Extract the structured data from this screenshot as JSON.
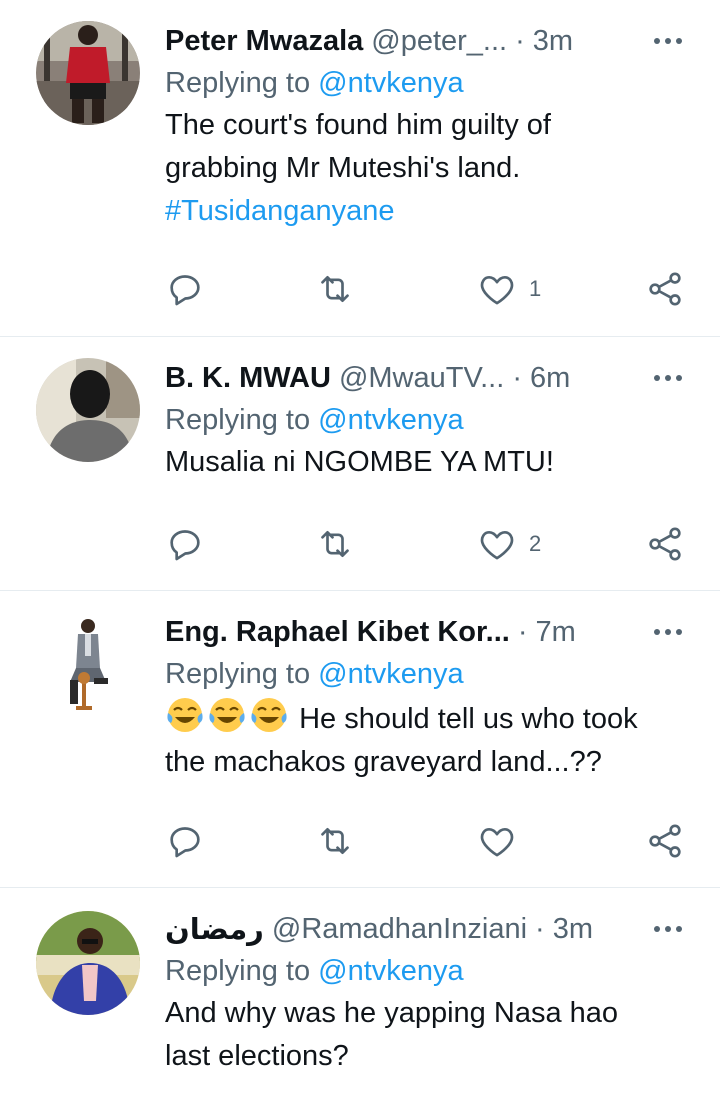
{
  "replying_prefix": "Replying to",
  "tweets": [
    {
      "name": "Peter Mwazala",
      "handle": "@peter_...",
      "dot": "·",
      "time": "3m",
      "reply_to": "@ntvkenya",
      "text_line1": "The court's found him guilty of",
      "text_line2": "grabbing Mr Muteshi's land.",
      "hashtag": "#Tusidanganyane",
      "like_count": "1",
      "avatar_icon": "avatar-photo"
    },
    {
      "name": "B. K. MWAU",
      "handle": "@MwauTV...",
      "dot": "·",
      "time": "6m",
      "reply_to": "@ntvkenya",
      "text": "Musalia ni NGOMBE YA MTU!",
      "like_count": "2",
      "avatar_icon": "avatar-photo"
    },
    {
      "name": "Eng. Raphael Kibet Kor...",
      "dot": "·",
      "time": "7m",
      "reply_to": "@ntvkenya",
      "emoji_icon": "face-with-tears-of-joy-emoji",
      "text_line1": "He should tell us who took",
      "text_line2": "the machakos graveyard land...??",
      "avatar_icon": "avatar-photo"
    },
    {
      "name": "رمضان",
      "handle": "@RamadhanInziani",
      "dot": "·",
      "time": "3m",
      "reply_to": "@ntvkenya",
      "text_line1": "And why was he yapping Nasa hao",
      "text_line2": "last elections?",
      "avatar_icon": "avatar-photo"
    }
  ],
  "icons": {
    "reply": "reply-icon",
    "retweet": "retweet-icon",
    "like": "heart-icon",
    "share": "share-icon",
    "more": "more-icon"
  },
  "colors": {
    "link": "#1d9bf0",
    "secondary": "#536471",
    "divider": "#e6ecf0"
  }
}
